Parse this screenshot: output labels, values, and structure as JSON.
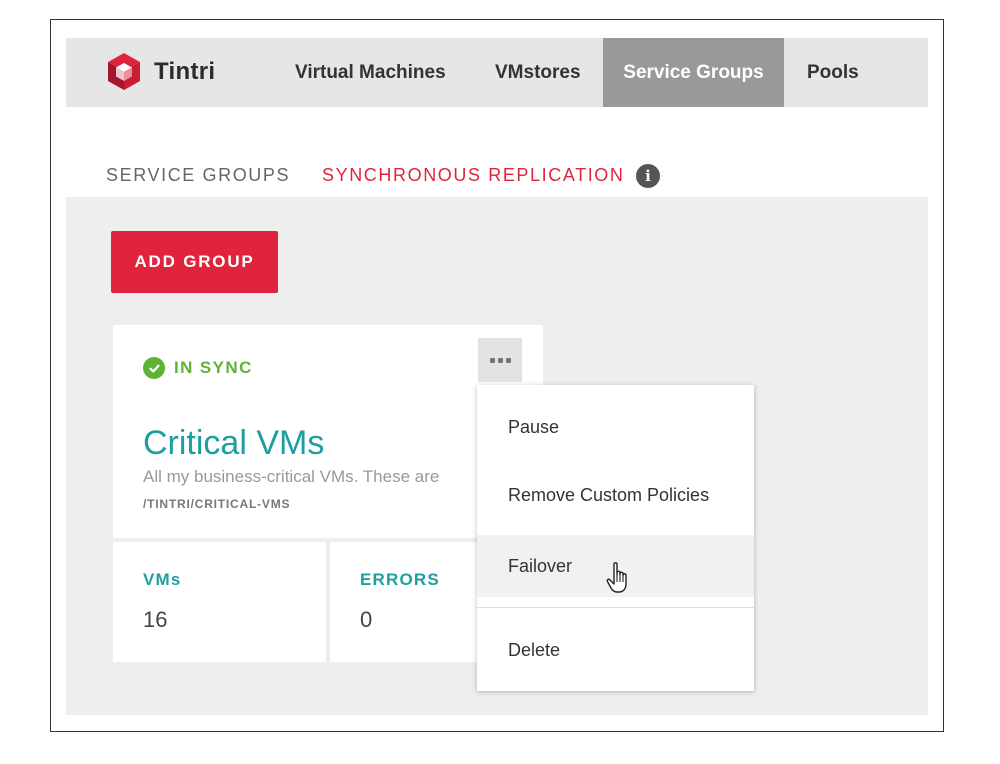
{
  "brand": {
    "name": "Tintri",
    "logo_icon": "tintri-cube-logo",
    "accent": "#e0243e"
  },
  "nav": {
    "items": [
      {
        "label": "Virtual Machines"
      },
      {
        "label": "VMstores"
      },
      {
        "label": "Service Groups",
        "active": true
      },
      {
        "label": "Pools"
      }
    ]
  },
  "subtabs": {
    "service_groups": "SERVICE GROUPS",
    "sync_replication": "SYNCHRONOUS REPLICATION",
    "active": "sync_replication",
    "info_icon": "info-icon"
  },
  "actions": {
    "add_group": "ADD GROUP"
  },
  "group_card": {
    "status": "IN SYNC",
    "status_color": "#5fb236",
    "title": "Critical VMs",
    "description": "All my business-critical VMs. These are",
    "path": "/TINTRI/CRITICAL-VMS",
    "stats": [
      {
        "label": "VMs",
        "value": "16"
      },
      {
        "label": "ERRORS",
        "value": "0"
      }
    ]
  },
  "menu": {
    "items": [
      {
        "label": "Pause"
      },
      {
        "label": "Remove Custom Policies"
      },
      {
        "label": "Failover",
        "hovered": true
      },
      {
        "label": "Delete"
      }
    ]
  }
}
